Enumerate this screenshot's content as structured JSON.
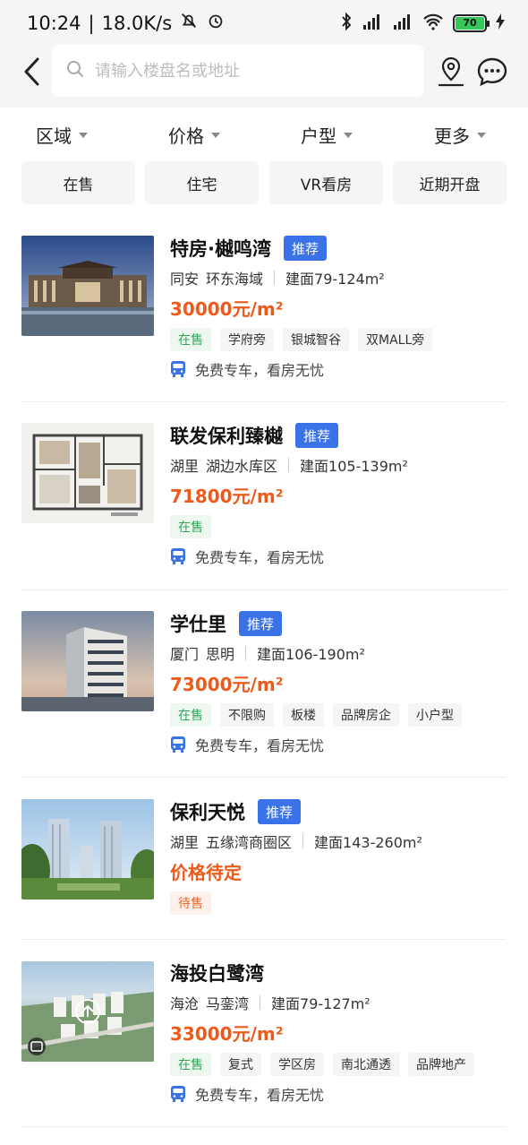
{
  "status_bar": {
    "time": "10:24",
    "speed": "18.0K/s",
    "battery": "70"
  },
  "header": {
    "search_placeholder": "请输入楼盘名或地址"
  },
  "filters": [
    {
      "label": "区域"
    },
    {
      "label": "价格"
    },
    {
      "label": "户型"
    },
    {
      "label": "更多"
    }
  ],
  "quick_filters": [
    {
      "label": "在售"
    },
    {
      "label": "住宅"
    },
    {
      "label": "VR看房"
    },
    {
      "label": "近期开盘"
    }
  ],
  "listings": [
    {
      "name": "特房·樾鸣湾",
      "badge": "推荐",
      "city": "同安",
      "district": "环东海域",
      "area": "建面79-124m²",
      "price": "30000元/m²",
      "tags": [
        {
          "label": "在售",
          "type": "onsale"
        },
        {
          "label": "学府旁",
          "type": "normal"
        },
        {
          "label": "银城智谷",
          "type": "normal"
        },
        {
          "label": "双MALL旁",
          "type": "normal"
        }
      ],
      "bus_text": "免费专车，看房无忧"
    },
    {
      "name": "联发保利臻樾",
      "badge": "推荐",
      "city": "湖里",
      "district": "湖边水库区",
      "area": "建面105-139m²",
      "price": "71800元/m²",
      "tags": [
        {
          "label": "在售",
          "type": "onsale"
        }
      ],
      "bus_text": "免费专车，看房无忧"
    },
    {
      "name": "学仕里",
      "badge": "推荐",
      "city": "厦门",
      "district": "思明",
      "area": "建面106-190m²",
      "price": "73000元/m²",
      "tags": [
        {
          "label": "在售",
          "type": "onsale"
        },
        {
          "label": "不限购",
          "type": "normal"
        },
        {
          "label": "板楼",
          "type": "normal"
        },
        {
          "label": "品牌房企",
          "type": "normal"
        },
        {
          "label": "小户型",
          "type": "normal"
        }
      ],
      "bus_text": "免费专车，看房无忧"
    },
    {
      "name": "保利天悦",
      "badge": "推荐",
      "city": "湖里",
      "district": "五缘湾商圈区",
      "area": "建面143-260m²",
      "price": "价格待定",
      "tags": [
        {
          "label": "待售",
          "type": "pending"
        }
      ],
      "bus_text": ""
    },
    {
      "name": "海投白鹭湾",
      "badge": "",
      "city": "海沧",
      "district": "马銮湾",
      "area": "建面79-127m²",
      "price": "33000元/m²",
      "tags": [
        {
          "label": "在售",
          "type": "onsale"
        },
        {
          "label": "复式",
          "type": "normal"
        },
        {
          "label": "学区房",
          "type": "normal"
        },
        {
          "label": "南北通透",
          "type": "normal"
        },
        {
          "label": "品牌地产",
          "type": "normal"
        }
      ],
      "bus_text": "免费专车，看房无忧"
    }
  ],
  "colors": {
    "price": "#ef5a1a",
    "badge": "#3a73e8",
    "onsale": "#2fa65a",
    "pending": "#e8672b"
  }
}
